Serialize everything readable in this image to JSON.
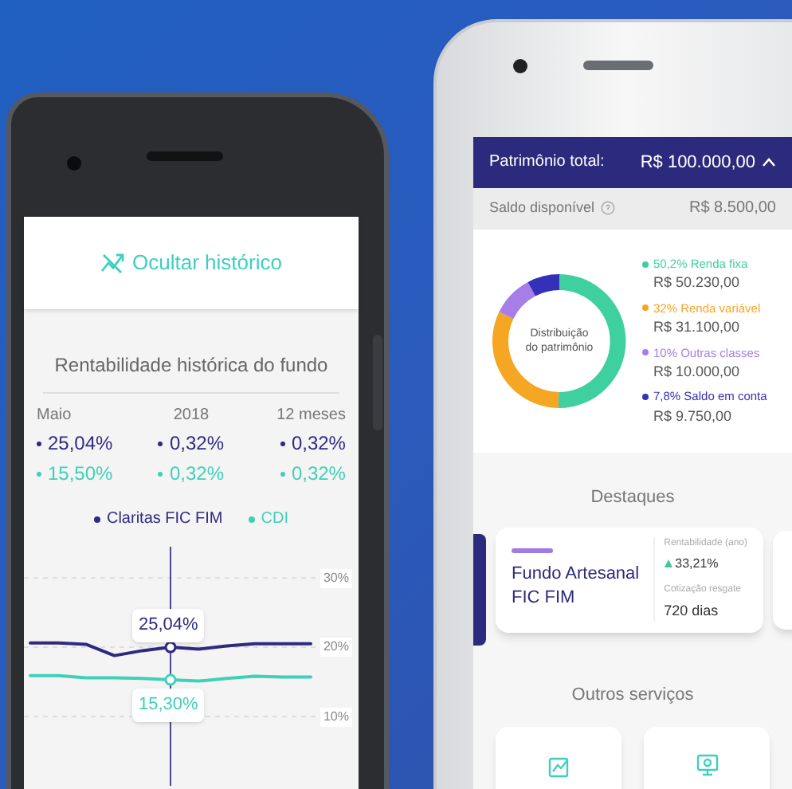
{
  "left_phone": {
    "toggle": {
      "label": "Ocultar histórico"
    },
    "title": "Rentabilidade histórica do fundo",
    "columns": [
      {
        "label": "Maio",
        "fund": "25,04%",
        "cdi": "15,50%"
      },
      {
        "label": "2018",
        "fund": "0,32%",
        "cdi": "0,32%"
      },
      {
        "label": "12 meses",
        "fund": "0,32%",
        "cdi": "0,32%"
      }
    ],
    "chart_data": {
      "type": "line",
      "grid": true,
      "ylim": [
        0,
        34.5
      ],
      "yticks": [
        {
          "value": 10,
          "label": "10%"
        },
        {
          "value": 20,
          "label": "20%"
        },
        {
          "value": 30,
          "label": "30%"
        }
      ],
      "series": [
        {
          "name": "Claritas FIC FIM",
          "color": "#2e2a80",
          "values": [
            20.6,
            20.6,
            20.4,
            18.8,
            19.5,
            20,
            19.7,
            20.2,
            20.5,
            20.5,
            20.5
          ]
        },
        {
          "name": "CDI",
          "color": "#3fd0b9",
          "values": [
            15.9,
            15.9,
            15.6,
            15.6,
            15.5,
            15.3,
            15.1,
            15.5,
            15.8,
            15.7,
            15.7
          ]
        }
      ]
    },
    "tooltips": [
      {
        "label": "25,04%"
      },
      {
        "label": "15,30%"
      }
    ]
  },
  "right_phone": {
    "header": {
      "label": "Patrimônio total:",
      "value": "R$ 100.000,00",
      "expanded": true
    },
    "balance": {
      "label": "Saldo disponível",
      "value": "R$ 8.500,00"
    },
    "chart_data": {
      "type": "donut",
      "title": "Distribuição do patrimônio",
      "series": [
        {
          "values": [
            50.2,
            32,
            10,
            7.8
          ]
        }
      ]
    },
    "legend": [
      {
        "label": "50,2% Renda fixa",
        "amount": "R$ 50.230,00",
        "color": "#3fd0a0"
      },
      {
        "label": "32% Renda variável",
        "amount": "R$ 31.100,00",
        "color": "#f5a623"
      },
      {
        "label": "10% Outras classes",
        "amount": "R$ 10.000,00",
        "color": "#a77ee8"
      },
      {
        "label": "7,8% Saldo em conta",
        "amount": "R$ 9.750,00",
        "color": "#3530b8"
      }
    ],
    "highlights_title": "Destaques",
    "highlight": {
      "name": "Fundo Artesanal FIC FIM",
      "stat_1_label": "Rentabilidade (ano)",
      "stat_1_value": "33,21%",
      "stat_2_label": "Cotização resgate",
      "stat_2_value": "720 dias"
    },
    "services_title": "Outros serviços"
  }
}
